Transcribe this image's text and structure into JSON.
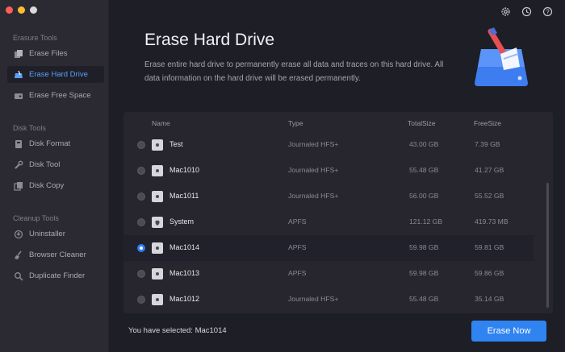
{
  "sidebar": {
    "sections": [
      {
        "title": "Erasure Tools",
        "items": [
          {
            "label": "Erase Files",
            "icon": "files-icon",
            "active": false
          },
          {
            "label": "Erase Hard Drive",
            "icon": "hard-drive-icon",
            "active": true
          },
          {
            "label": "Erase Free Space",
            "icon": "free-space-icon",
            "active": false
          }
        ]
      },
      {
        "title": "Disk Tools",
        "items": [
          {
            "label": "Disk Format",
            "icon": "format-icon",
            "active": false
          },
          {
            "label": "Disk Tool",
            "icon": "wrench-icon",
            "active": false
          },
          {
            "label": "Disk Copy",
            "icon": "copy-icon",
            "active": false
          }
        ]
      },
      {
        "title": "Cleanup Tools",
        "items": [
          {
            "label": "Uninstaller",
            "icon": "uninstaller-icon",
            "active": false
          },
          {
            "label": "Browser Cleaner",
            "icon": "broom-icon",
            "active": false
          },
          {
            "label": "Duplicate Finder",
            "icon": "magnifier-icon",
            "active": false
          }
        ]
      }
    ]
  },
  "header": {
    "title": "Erase Hard Drive",
    "description": "Erase entire hard drive to permanently erase all data and traces on this hard drive. All data information on the hard drive will be erased permanently.",
    "icons": [
      "settings-icon",
      "history-icon",
      "help-icon"
    ]
  },
  "table": {
    "columns": [
      "Name",
      "Type",
      "TotalSize",
      "FreeSize"
    ],
    "rows": [
      {
        "name": "Test",
        "type": "Journaled HFS+",
        "total": "43.00 GB",
        "free": "7.39 GB",
        "selected": false
      },
      {
        "name": "Mac1010",
        "type": "Journaled HFS+",
        "total": "55.48 GB",
        "free": "41.27 GB",
        "selected": false
      },
      {
        "name": "Mac1011",
        "type": "Journaled HFS+",
        "total": "56.00 GB",
        "free": "55.52 GB",
        "selected": false
      },
      {
        "name": "System",
        "type": "APFS",
        "total": "121.12 GB",
        "free": "419.73 MB",
        "selected": false
      },
      {
        "name": "Mac1014",
        "type": "APFS",
        "total": "59.98 GB",
        "free": "59.81 GB",
        "selected": true
      },
      {
        "name": "Mac1013",
        "type": "APFS",
        "total": "59.98 GB",
        "free": "59.86 GB",
        "selected": false
      },
      {
        "name": "Mac1012",
        "type": "Journaled HFS+",
        "total": "55.48 GB",
        "free": "35.14 GB",
        "selected": false
      }
    ]
  },
  "footer": {
    "selected_text": "You have selected: Mac1014",
    "erase_button": "Erase Now"
  },
  "colors": {
    "accent": "#2f84f2",
    "active_nav": "#5aa0ff"
  }
}
